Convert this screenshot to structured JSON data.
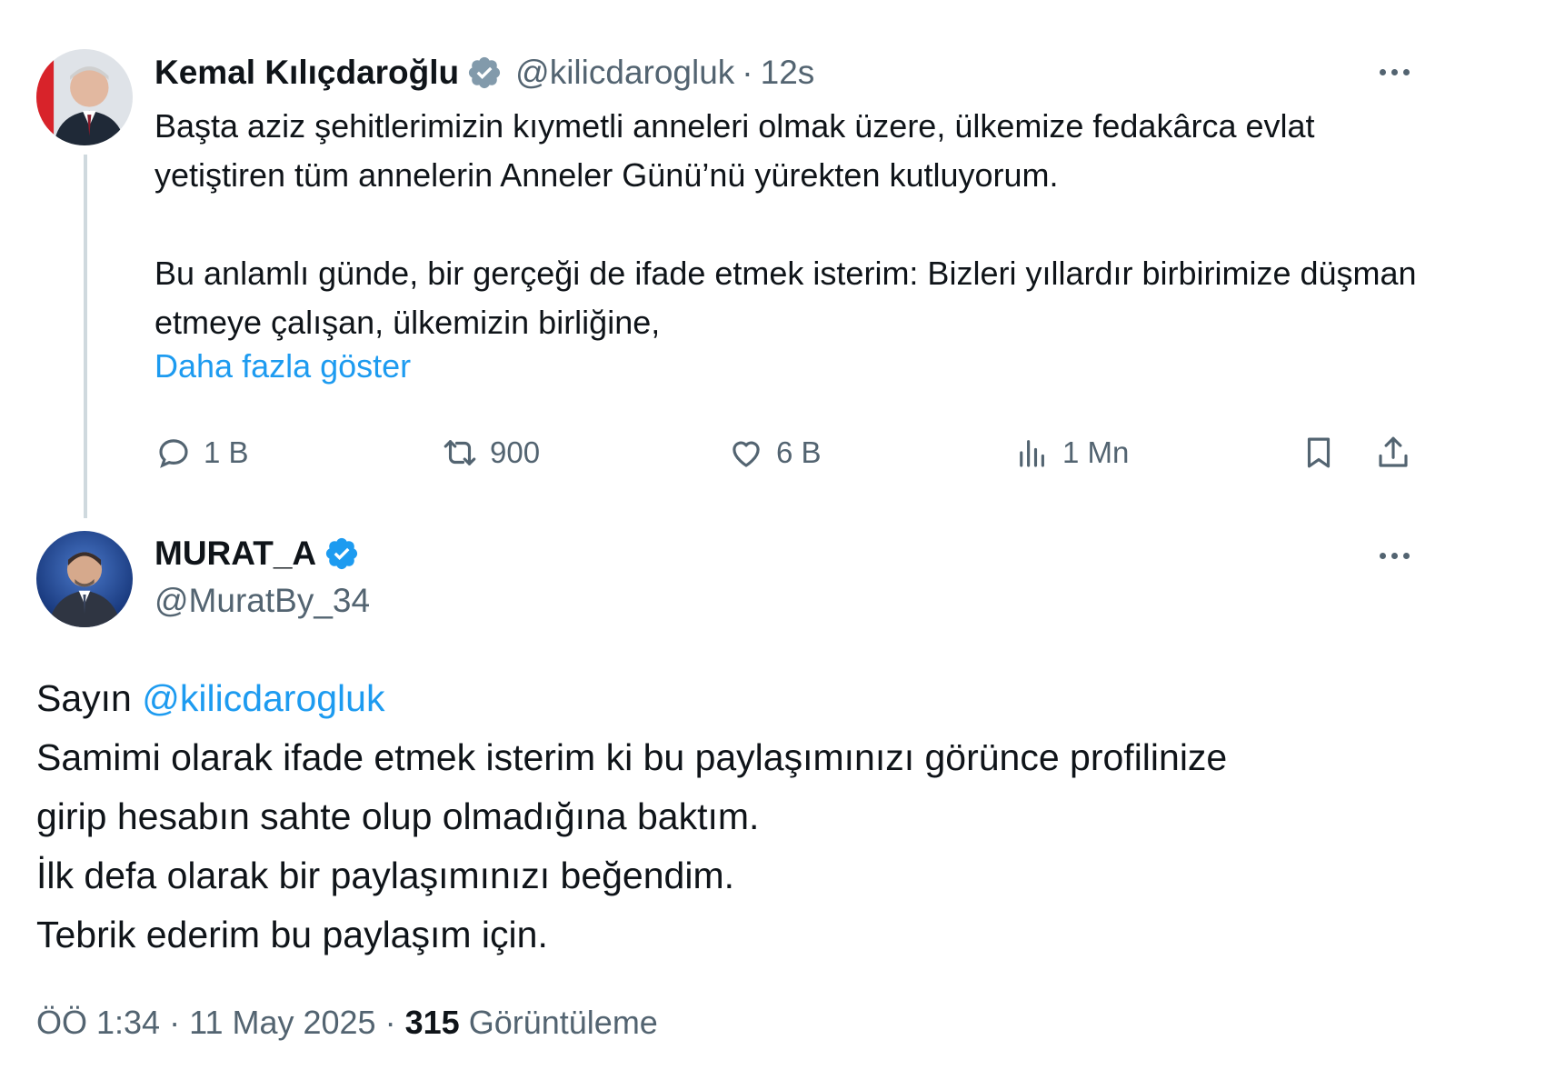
{
  "original_tweet": {
    "display_name": "Kemal Kılıçdaroğlu",
    "handle": "@kilicdarogluk",
    "separator": "·",
    "time": "12s",
    "paragraphs": [
      "Başta aziz şehitlerimizin kıymetli anneleri olmak üzere, ülkemize fedakârca evlat yetiştiren tüm annelerin Anneler Günü’nü yürekten kutluyorum.",
      "Bu anlamlı günde, bir gerçeği de ifade etmek isterim: Bizleri yıllardır birbirimize düşman etmeye çalışan, ülkemizin birliğine,"
    ],
    "show_more": "Daha fazla göster",
    "actions": {
      "replies": "1 B",
      "retweets": "900",
      "likes": "6 B",
      "views": "1 Mn"
    }
  },
  "reply_tweet": {
    "display_name": "MURAT_A",
    "handle": "@MuratBy_34",
    "greeting": "Sayın",
    "mention": "@kilicdarogluk",
    "lines": [
      "Samimi olarak ifade etmek isterim ki bu paylaşımınızı görünce profilinize",
      "girip hesabın sahte olup olmadığına baktım.",
      "İlk defa olarak bir paylaşımınızı beğendim.",
      "Tebrik ederim bu paylaşım için."
    ],
    "meta": {
      "time": "ÖÖ 1:34",
      "separator": "·",
      "date": "11 May 2025",
      "separator2": "·",
      "views_count": "315",
      "views_label": "Görüntüleme"
    }
  },
  "icons": {
    "verified_original": "verified-badge-gray",
    "verified_reply": "verified-badge-blue",
    "actions": [
      "reply-icon",
      "retweet-icon",
      "like-icon",
      "views-icon",
      "bookmark-icon",
      "share-icon"
    ]
  },
  "colors": {
    "text": "#0f1419",
    "secondary": "#536471",
    "link": "#1d9bf0",
    "verified_gray": "#829aab",
    "verified_blue": "#1d9bf0"
  }
}
